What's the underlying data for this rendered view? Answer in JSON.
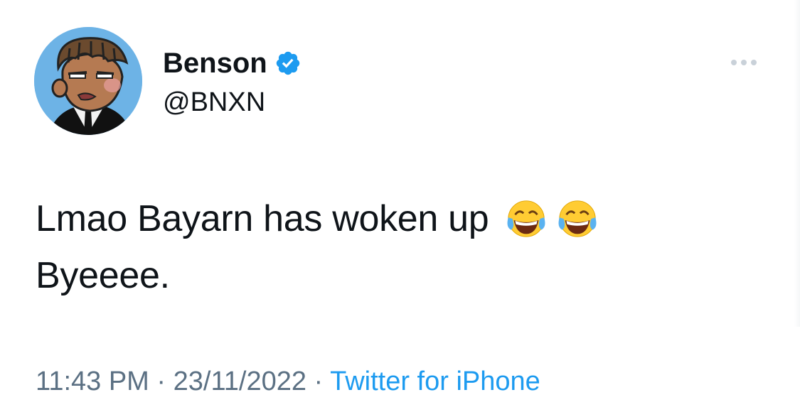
{
  "tweet": {
    "author": {
      "display_name": "Benson",
      "handle": "@BNXN",
      "verified": true,
      "avatar": "cartoon-avatar"
    },
    "more_icon": "more-horizontal-icon",
    "text_lines": [
      "Lmao Bayarn has woken up",
      "Byeeee."
    ],
    "emojis": [
      "face-with-tears-of-joy",
      "face-with-tears-of-joy"
    ],
    "meta": {
      "time": "11:43 PM",
      "separator": " · ",
      "date": "23/11/2022",
      "source": "Twitter for iPhone"
    },
    "colors": {
      "verified": "#1d9bf0",
      "source_link": "#1d9bf0",
      "meta_text": "#5b7083",
      "text": "#0f1419"
    }
  }
}
